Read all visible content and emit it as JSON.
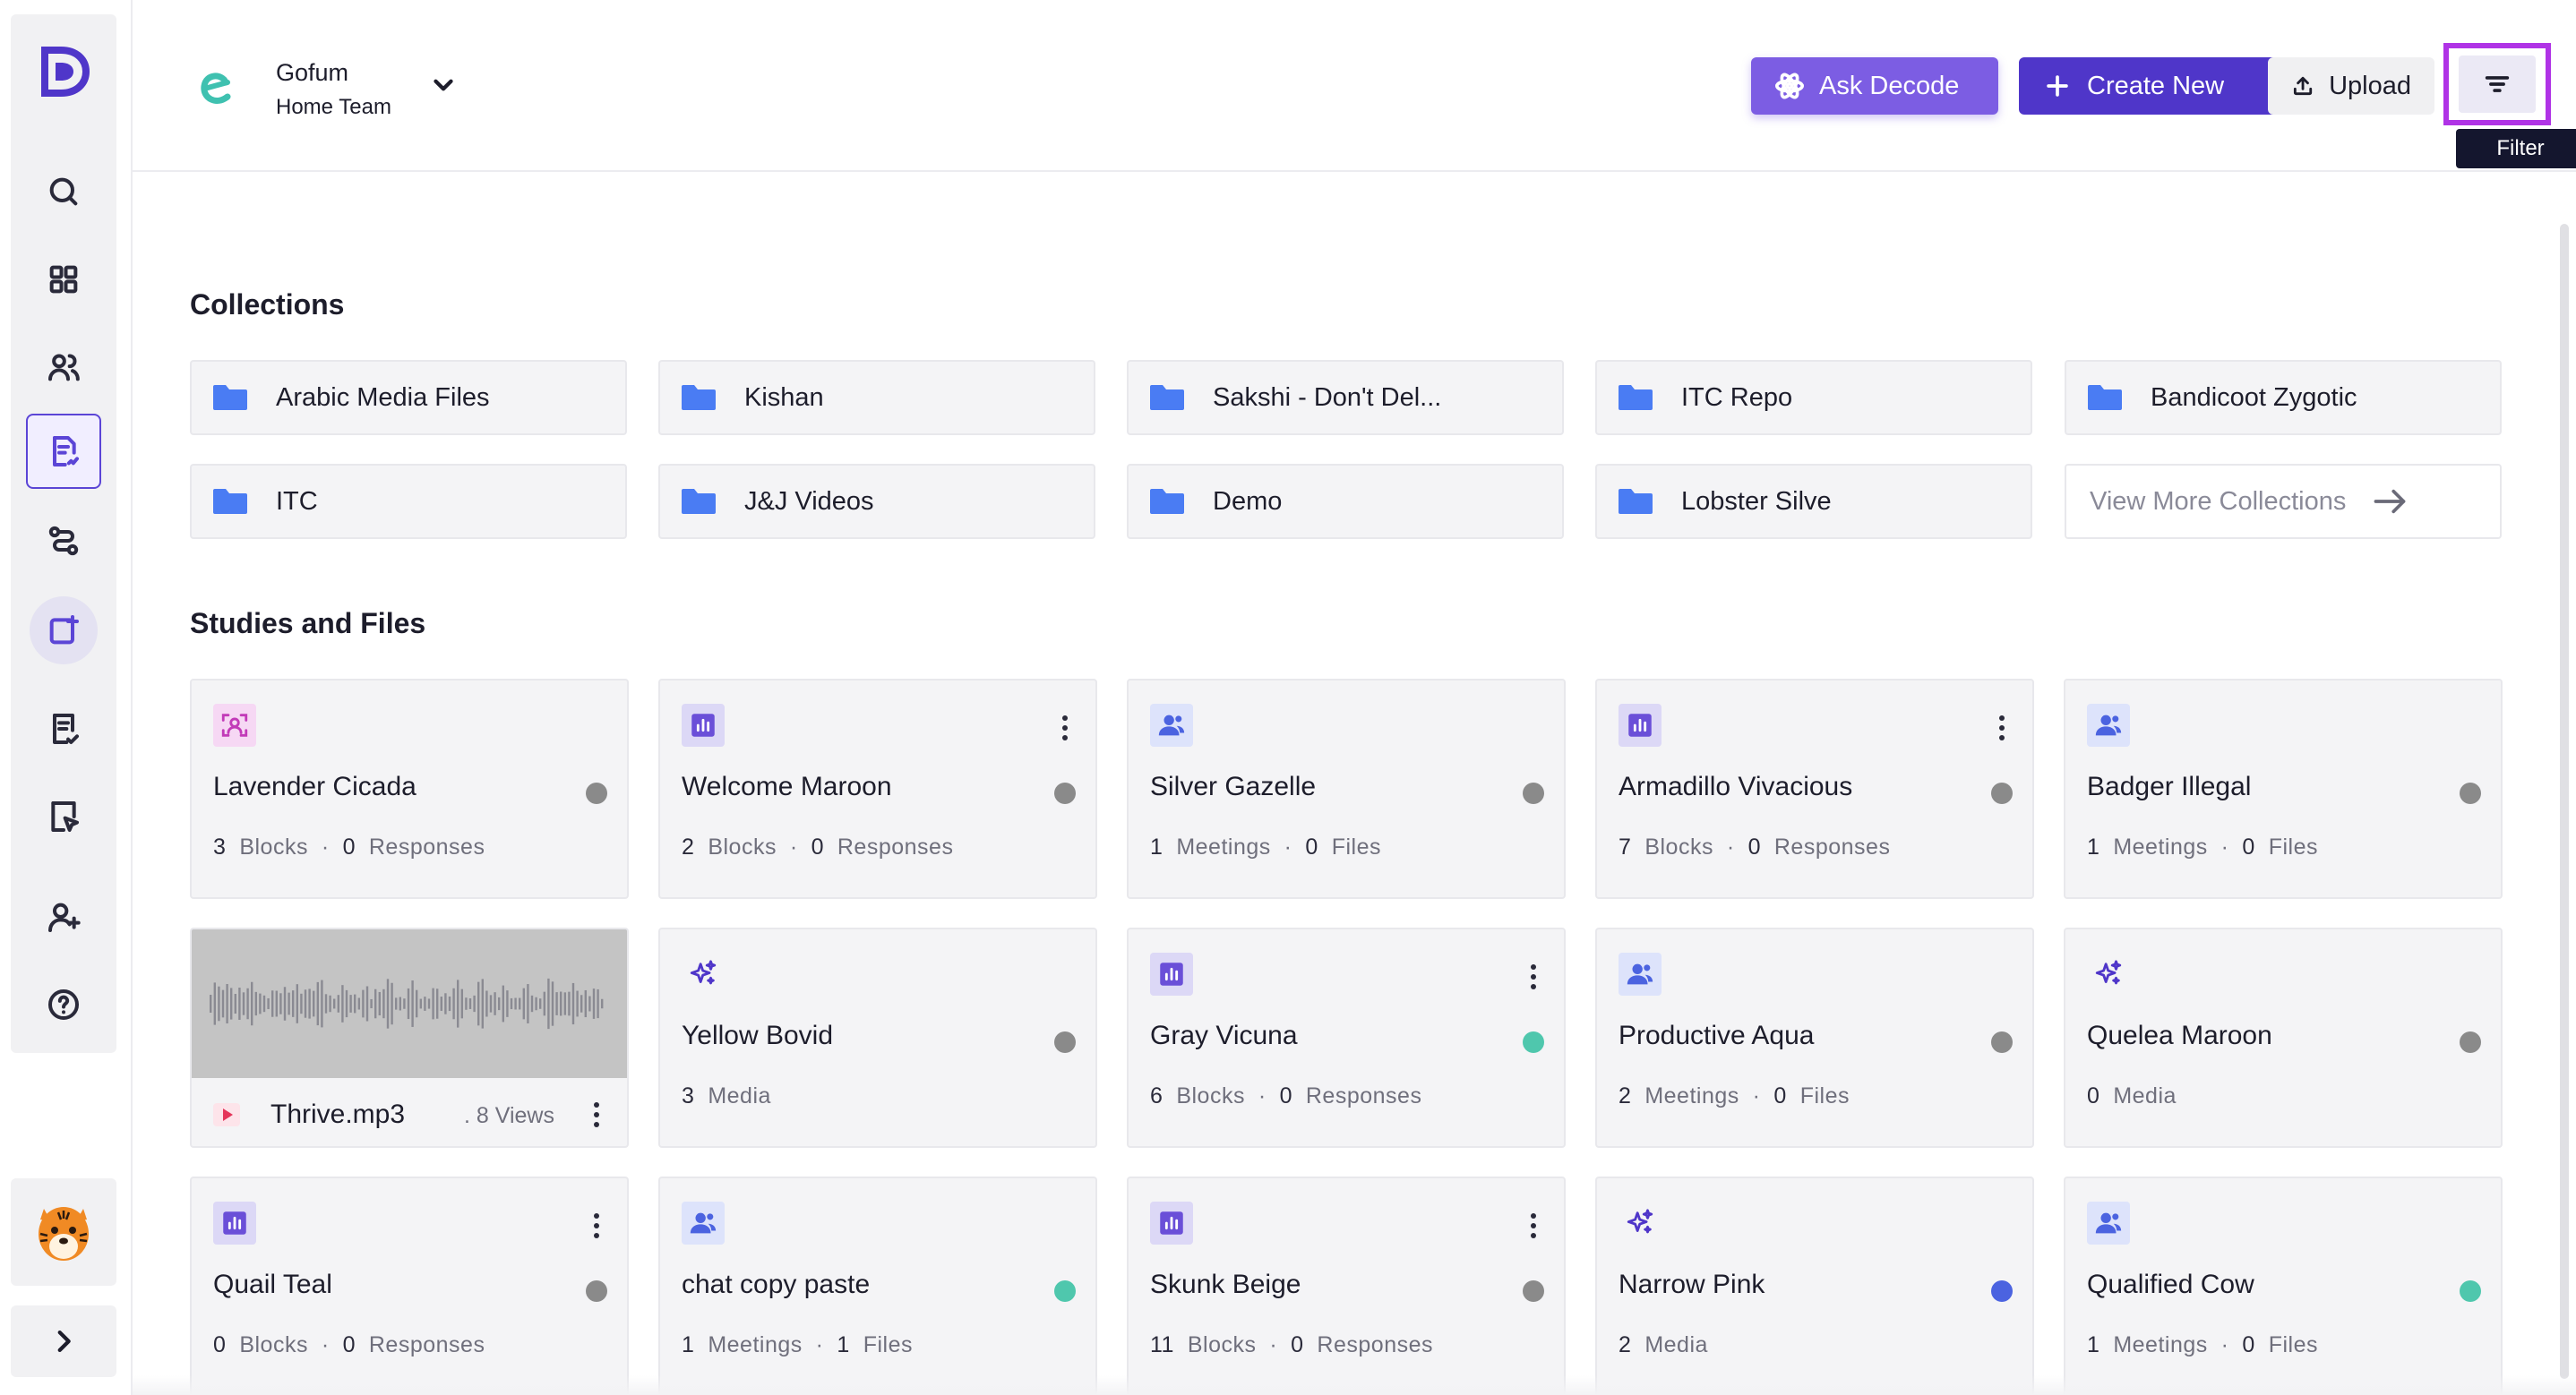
{
  "header": {
    "team_name": "Gofum",
    "team_sub": "Home Team",
    "ask_label": "Ask Decode",
    "create_label": "Create New",
    "upload_label": "Upload",
    "filter_tooltip": "Filter"
  },
  "sidebar": {
    "items": [
      "search-icon",
      "grid-icon",
      "users-icon",
      "studies-icon",
      "flows-icon",
      "add-doc-icon",
      "checklist-icon",
      "forms-icon",
      "add-user-icon",
      "help-icon"
    ],
    "active": "studies-icon"
  },
  "collections": {
    "title": "Collections",
    "items": [
      "Arabic Media Files",
      "Kishan",
      "Sakshi - Don't Del...",
      "ITC Repo",
      "Bandicoot Zygotic",
      "ITC",
      "J&J Videos",
      "Demo",
      "Lobster Silve"
    ],
    "view_more": "View More Collections"
  },
  "studies": {
    "title": "Studies and Files",
    "cards": [
      {
        "type": "interview",
        "title": "Lavender Cicada",
        "n1": "3",
        "l1": "Blocks",
        "n2": "0",
        "l2": "Responses",
        "status": "#8a8a8a",
        "menu": false
      },
      {
        "type": "survey",
        "title": "Welcome Maroon",
        "n1": "2",
        "l1": "Blocks",
        "n2": "0",
        "l2": "Responses",
        "status": "#8a8a8a",
        "menu": true
      },
      {
        "type": "meeting",
        "title": "Silver Gazelle",
        "n1": "1",
        "l1": "Meetings",
        "n2": "0",
        "l2": "Files",
        "status": "#8a8a8a",
        "menu": false
      },
      {
        "type": "survey",
        "title": "Armadillo Vivacious",
        "n1": "7",
        "l1": "Blocks",
        "n2": "0",
        "l2": "Responses",
        "status": "#8a8a8a",
        "menu": true
      },
      {
        "type": "meeting",
        "title": "Badger Illegal",
        "n1": "1",
        "l1": "Meetings",
        "n2": "0",
        "l2": "Files",
        "status": "#8a8a8a",
        "menu": false
      },
      {
        "type": "media-file",
        "title": "Thrive.mp3",
        "views": "8 Views"
      },
      {
        "type": "ai",
        "title": "Yellow Bovid",
        "n1": "3",
        "l1": "Media",
        "status": "#8a8a8a",
        "menu": false
      },
      {
        "type": "survey",
        "title": "Gray Vicuna",
        "n1": "6",
        "l1": "Blocks",
        "n2": "0",
        "l2": "Responses",
        "status": "#4fc7ad",
        "menu": true
      },
      {
        "type": "meeting",
        "title": "Productive Aqua",
        "n1": "2",
        "l1": "Meetings",
        "n2": "0",
        "l2": "Files",
        "status": "#8a8a8a",
        "menu": false
      },
      {
        "type": "ai",
        "title": "Quelea Maroon",
        "n1": "0",
        "l1": "Media",
        "status": "#8a8a8a",
        "menu": false
      },
      {
        "type": "survey",
        "title": "Quail Teal",
        "n1": "0",
        "l1": "Blocks",
        "n2": "0",
        "l2": "Responses",
        "status": "#8a8a8a",
        "menu": true
      },
      {
        "type": "meeting",
        "title": "chat copy paste",
        "n1": "1",
        "l1": "Meetings",
        "n2": "1",
        "l2": "Files",
        "status": "#4fc7ad",
        "menu": false
      },
      {
        "type": "survey",
        "title": "Skunk Beige",
        "n1": "11",
        "l1": "Blocks",
        "n2": "0",
        "l2": "Responses",
        "status": "#8a8a8a",
        "menu": true
      },
      {
        "type": "ai",
        "title": "Narrow Pink",
        "n1": "2",
        "l1": "Media",
        "status": "#4b63e0",
        "menu": false
      },
      {
        "type": "meeting",
        "title": "Qualified Cow",
        "n1": "1",
        "l1": "Meetings",
        "n2": "0",
        "l2": "Files",
        "status": "#4fc7ad",
        "menu": false
      }
    ]
  },
  "colors": {
    "accent": "#4f36c9",
    "ask_button": "#7c5de3",
    "folder": "#4a7cf3",
    "highlight_border": "#b033e6"
  }
}
